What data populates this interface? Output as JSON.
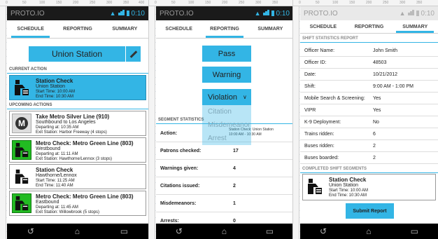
{
  "app": {
    "name": "PROTO.IO",
    "time": "0:10"
  },
  "tabs": [
    "SCHEDULE",
    "REPORTING",
    "SUMMARY"
  ],
  "ruler": [
    "0",
    "50",
    "100",
    "150",
    "200",
    "250",
    "300",
    "350",
    "400",
    "450"
  ],
  "schedule": {
    "station_title": "Union Station",
    "current_header": "CURRENT ACTION",
    "upcoming_header": "UPCOMING ACTIONS",
    "current": {
      "title": "Station Check",
      "line2": "Union Station",
      "line3": "Start Time:   10:00 AM",
      "line4": "End Time:    10:30 AM"
    },
    "upcoming": [
      {
        "title": "Take Metro Silver Line (910)",
        "line2": "Southbound to Los Angeles",
        "line3": "Departing at: 10:35 AM",
        "line4": "Exit Station: Harbor Freeway (4 stops)",
        "icon": "metro-icon"
      },
      {
        "title": "Metro Check: Metro Green Line (803)",
        "line2": "Westbound",
        "line3": "Departing at: 11:11 AM",
        "line4": "Exit Station: Hawthorne/Lennox (3 stops)",
        "icon": "officer-icon"
      },
      {
        "title": "Station Check",
        "line2": "Hawthorne/Lennox",
        "line3": "Start Time:   11:25 AM",
        "line4": "End Time:    11:40 AM",
        "icon": "officer-icon"
      },
      {
        "title": "Metro Check: Metro Green Line (803)",
        "line2": "Eastbound",
        "line3": "Departing at: 11:45 AM",
        "line4": "Exit Station: Willowbrook (5 stops)",
        "icon": "officer-icon"
      }
    ]
  },
  "reporting": {
    "pass": "Pass",
    "warning": "Warning",
    "violation": "Violation",
    "options": [
      "Citation",
      "Misdemeanor",
      "Arrest"
    ],
    "segment_header": "SEGMENT STATISTICS",
    "overlay_text": "Station Check: Union Station",
    "overlay_time": "10:00 AM - 10:30 AM",
    "stats": [
      {
        "label": "Action:",
        "value": ""
      },
      {
        "label": "Patrons checked:",
        "value": "17"
      },
      {
        "label": "Warnings given:",
        "value": "4"
      },
      {
        "label": "Citations issued:",
        "value": "2"
      },
      {
        "label": "Misdemeanors:",
        "value": "1"
      },
      {
        "label": "Arrests:",
        "value": "0"
      }
    ]
  },
  "summary": {
    "report_header": "SHIFT STATISTICS REPORT",
    "rows": [
      {
        "label": "Officer Name:",
        "value": "John Smith"
      },
      {
        "label": "Officer ID:",
        "value": "48503"
      },
      {
        "label": "Date:",
        "value": "10/21/2012"
      },
      {
        "label": "Shift:",
        "value": "9:00 AM - 1:00 PM"
      },
      {
        "label": "Mobile Search & Screening:",
        "value": "Yes"
      },
      {
        "label": "VIPR",
        "value": "Yes"
      },
      {
        "label": "K-9 Deployment:",
        "value": "No"
      },
      {
        "label": "Trains ridden:",
        "value": "6"
      },
      {
        "label": "Buses ridden:",
        "value": "2"
      },
      {
        "label": "Buses boarded:",
        "value": "2"
      }
    ],
    "completed_header": "COMPLETED SHIFT SEGMENTS",
    "completed": {
      "title": "Station Check",
      "line2": "Union Station",
      "line3": "Start Time:   10:00 AM",
      "line4": "End Time:    10:30 AM"
    },
    "submit": "Submit Report"
  },
  "colors": {
    "accent": "#33b5e5",
    "green": "#22bb22"
  }
}
